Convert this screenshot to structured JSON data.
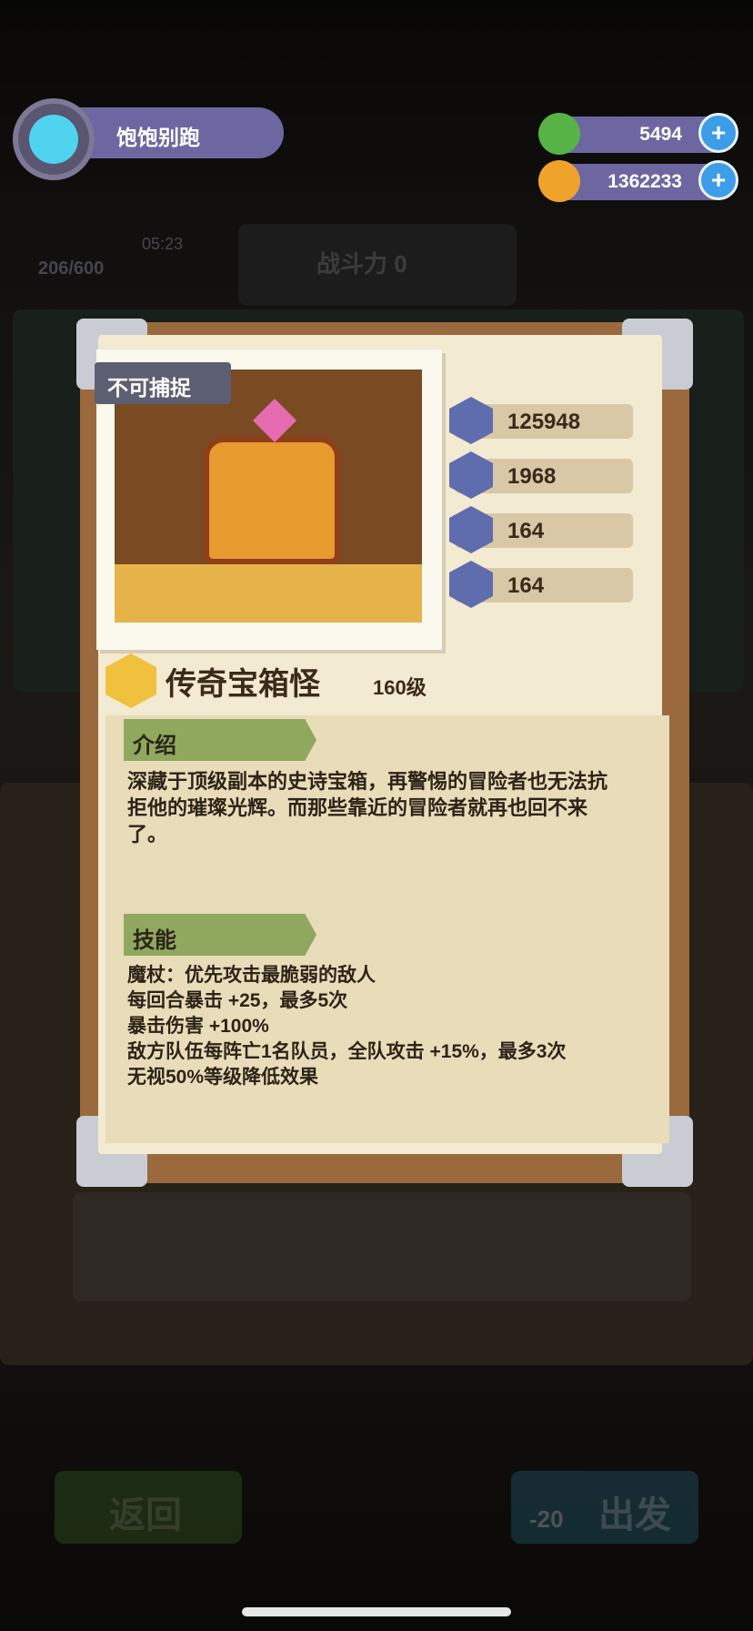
{
  "player": {
    "name": "饱饱别跑"
  },
  "resources": {
    "gems": {
      "value": "5494",
      "icon": "donut-coin-icon",
      "color": "#58b347"
    },
    "gold": {
      "value": "1362233",
      "icon": "planet-coin-icon",
      "color": "#f0a32a"
    }
  },
  "background": {
    "energy": "206/600",
    "timer": "05:23",
    "power": "战斗力 0",
    "back_label": "返回",
    "go_label": "出发",
    "go_cost": "-20"
  },
  "monster": {
    "tag": "不可捕捉",
    "name": "传奇宝箱怪",
    "level": "160级",
    "stats": [
      {
        "icon": "heart-icon",
        "value": "125948"
      },
      {
        "icon": "attack-icon",
        "value": "1968"
      },
      {
        "icon": "shield-icon",
        "value": "164"
      },
      {
        "icon": "resist-icon",
        "value": "164"
      }
    ],
    "intro_title": "介绍",
    "intro_text": "深藏于顶级副本的史诗宝箱，再警惕的冒险者也无法抗拒他的璀璨光辉。而那些靠近的冒险者就再也回不来了。",
    "skills_title": "技能",
    "skills": [
      "魔杖：优先攻击最脆弱的敌人",
      "每回合暴击 +25，最多5次",
      "暴击伤害 +100%",
      "敌方队伍每阵亡1名队员，全队攻击 +15%，最多3次",
      "无视50%等级降低效果"
    ]
  }
}
